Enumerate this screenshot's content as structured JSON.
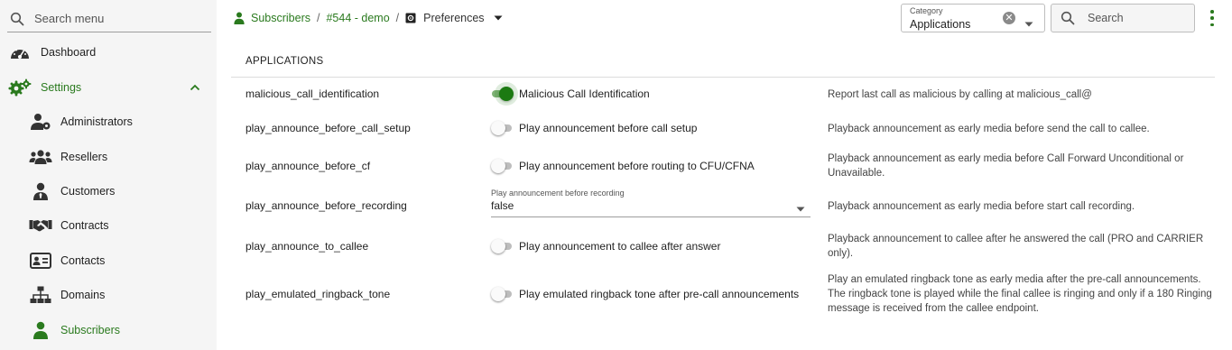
{
  "sidebar": {
    "search_placeholder": "Search menu",
    "items": [
      {
        "label": "Dashboard",
        "icon": "dashboard-gauge-icon"
      },
      {
        "label": "Settings",
        "icon": "settings-gears-icon",
        "active": true
      },
      {
        "label": "Administrators",
        "icon": "admin-user-gear-icon"
      },
      {
        "label": "Resellers",
        "icon": "resellers-group-icon"
      },
      {
        "label": "Customers",
        "icon": "customer-tie-icon"
      },
      {
        "label": "Contracts",
        "icon": "handshake-icon"
      },
      {
        "label": "Contacts",
        "icon": "contact-card-icon"
      },
      {
        "label": "Domains",
        "icon": "domains-sitemap-icon"
      },
      {
        "label": "Subscribers",
        "icon": "subscriber-user-icon",
        "active": true
      }
    ]
  },
  "breadcrumb": {
    "subscribers": "Subscribers",
    "sep": "/",
    "subscriber": "#544 - demo",
    "current": "Preferences"
  },
  "category": {
    "label": "Category",
    "value": "Applications"
  },
  "search": {
    "placeholder": "Search"
  },
  "section_title": "APPLICATIONS",
  "preferences": [
    {
      "key": "malicious_call_identification",
      "type": "toggle",
      "on": true,
      "label": "Malicious Call Identification",
      "description": "Report last call as malicious by calling at malicious_call@"
    },
    {
      "key": "play_announce_before_call_setup",
      "type": "toggle",
      "on": false,
      "label": "Play announcement before call setup",
      "description": "Playback announcement as early media before send the call to callee."
    },
    {
      "key": "play_announce_before_cf",
      "type": "toggle",
      "on": false,
      "label": "Play announcement before routing to CFU/CFNA",
      "description": "Playback announcement as early media before Call Forward Unconditional or Unavailable."
    },
    {
      "key": "play_announce_before_recording",
      "type": "select",
      "label": "Play announcement before recording",
      "value": "false",
      "description": "Playback announcement as early media before start call recording."
    },
    {
      "key": "play_announce_to_callee",
      "type": "toggle",
      "on": false,
      "label": "Play announcement to callee after answer",
      "description": "Playback announcement to callee after he answered the call (PRO and CARRIER only)."
    },
    {
      "key": "play_emulated_ringback_tone",
      "type": "toggle",
      "on": false,
      "label": "Play emulated ringback tone after pre-call announcements",
      "description": "Play an emulated ringback tone as early media after the pre-call announcements. The ringback tone is played while the final callee is ringing and only if a 180 Ringing message is received from the callee endpoint."
    }
  ],
  "colors": {
    "accent": "#2a7a1e",
    "toggle_on": "#1c7a12"
  }
}
